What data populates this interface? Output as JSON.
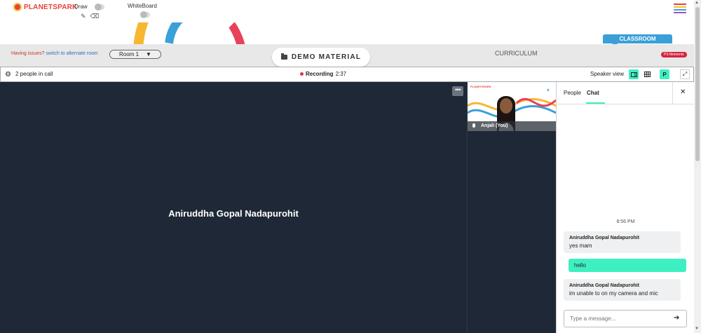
{
  "brand": {
    "logo_text": "PLANETSPARK"
  },
  "topbar": {
    "draw_label": "Draw",
    "whiteboard_label": "WhiteBoard",
    "tools": [
      "pencil-icon",
      "eraser-icon"
    ]
  },
  "header": {
    "classroom_tab": "CLASSROOM",
    "issue_text": "Having issues?",
    "alternate_link": "switch to alternate room",
    "room_select": "Room 1",
    "demo_material": "DEMO MATERIAL",
    "curriculum": "CURRICULUM",
    "ps_moments": "PS Moments"
  },
  "callbar": {
    "people_count": "2 people in call",
    "recording_label": "Recording",
    "recording_time": "2:37",
    "view_label": "Speaker view",
    "participant_initial": "P"
  },
  "video": {
    "main_speaker": "Aniruddha Gopal Nadapurohit",
    "tile_logo": "PLANETSPARK",
    "tile_name": "Anjali (You)"
  },
  "panel": {
    "tabs": [
      {
        "label": "People",
        "active": false
      },
      {
        "label": "Chat",
        "active": true
      }
    ],
    "timestamp": "8:56 PM",
    "messages": [
      {
        "sender": "Aniruddha Gopal Nadapurohit",
        "text": "yes mam",
        "mine": false
      },
      {
        "sender": "",
        "text": "hello",
        "mine": true
      },
      {
        "sender": "Aniruddha Gopal Nadapurohit",
        "text": "im unable to on my camera and mic",
        "mine": false
      }
    ],
    "input_placeholder": "Type a message..."
  },
  "colors": {
    "accent": "#3ef0c1",
    "brand_red": "#e8413a",
    "video_bg": "#1f2836",
    "classroom_blue": "#3aa0d8",
    "recording_red": "#e0354a"
  }
}
